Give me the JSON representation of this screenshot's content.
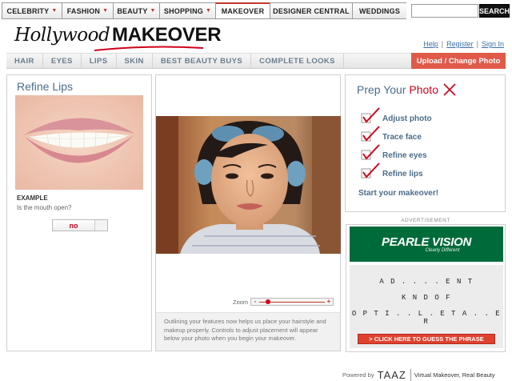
{
  "topnav": {
    "items": [
      {
        "label": "CELEBRITY",
        "caret": true
      },
      {
        "label": "FASHION",
        "caret": true
      },
      {
        "label": "BEAUTY",
        "caret": true
      },
      {
        "label": "SHOPPING",
        "caret": true
      },
      {
        "label": "MAKEOVER",
        "caret": false
      },
      {
        "label": "DESIGNER CENTRAL",
        "caret": false
      },
      {
        "label": "WEDDINGS",
        "caret": false
      }
    ],
    "search_label": "SEARCH"
  },
  "logo": {
    "part1": "Hollywood",
    "part2": "MAKEOVER"
  },
  "toplinks": {
    "help": "Help",
    "register": "Register",
    "signin": "Sign In",
    "sep": "|"
  },
  "subnav": {
    "items": [
      "HAIR",
      "EYES",
      "LIPS",
      "SKIN",
      "BEST BEAUTY BUYS",
      "COMPLETE LOOKS"
    ],
    "upload": "Upload / Change Photo"
  },
  "left": {
    "title": "Refine Lips",
    "example": "EXAMPLE",
    "question": "Is the mouth open?",
    "answer": "no"
  },
  "middle": {
    "zoom_label": "Zoom",
    "zoom_minus": "-",
    "zoom_plus": "+",
    "zoom_level": 0.1,
    "footer": "Outlining your features now helps us place your hairstyle and makeup properly. Controls to adjust placement will appear below your photo when you begin your makeover."
  },
  "prep": {
    "title_a": "Prep Your ",
    "title_b": "Photo",
    "steps": [
      "Adjust photo",
      "Trace face",
      "Refine eyes",
      "Refine lips"
    ],
    "start": "Start your makeover!"
  },
  "ad": {
    "label": "ADVERTISEMENT",
    "brand": "PEARLE VISION",
    "tagline": "Clearly Different",
    "phrase_lines": [
      "A D . . . . E N T",
      "K N D   O F",
      "O P T I . . L   . E T A . . E R"
    ],
    "cta": "> CLICK HERE TO GUESS THE PHRASE"
  },
  "footer": {
    "powered": "Powered by",
    "brand": "TAAZ",
    "slogan": "Virtual Makeover, Real Beauty"
  },
  "colors": {
    "accent": "#d0021b",
    "blue": "#4a6d8c",
    "upload_bg": "#e05a4a",
    "ad_green": "#006b3a"
  }
}
